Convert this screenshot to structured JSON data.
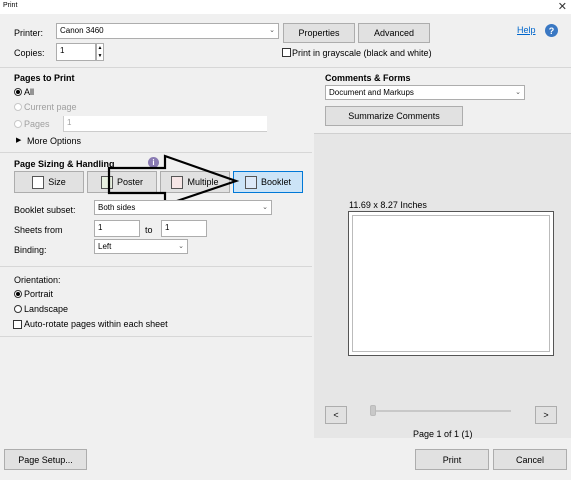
{
  "window": {
    "title": "Print"
  },
  "printer": {
    "label": "Printer:",
    "value": "Canon 3460",
    "properties_label": "Properties",
    "advanced_label": "Advanced"
  },
  "copies": {
    "label": "Copies:",
    "value": "1"
  },
  "grayscale": {
    "label": "Print in grayscale (black and white)"
  },
  "help": {
    "label": "Help"
  },
  "pages_to_print": {
    "title": "Pages to Print",
    "all_label": "All",
    "current_label": "Current page",
    "pages_label": "Pages",
    "pages_value": "1",
    "more_options_label": "More Options"
  },
  "sizing": {
    "title": "Page Sizing & Handling",
    "buttons": {
      "size": "Size",
      "poster": "Poster",
      "multiple": "Multiple",
      "booklet": "Booklet"
    },
    "subset_label": "Booklet subset:",
    "subset_value": "Both sides",
    "sheets_label": "Sheets from",
    "sheets_from": "1",
    "to_label": "to",
    "sheets_to": "1",
    "binding_label": "Binding:",
    "binding_value": "Left"
  },
  "orientation": {
    "title": "Orientation:",
    "portrait_label": "Portrait",
    "landscape_label": "Landscape",
    "autorotate_label": "Auto-rotate pages within each sheet"
  },
  "comments": {
    "title": "Comments & Forms",
    "value": "Document and Markups",
    "summarize_label": "Summarize Comments"
  },
  "preview": {
    "size_text": "11.69 x 8.27 Inches",
    "prev_label": "<",
    "next_label": ">",
    "page_text": "Page 1 of 1 (1)"
  },
  "footer": {
    "page_setup_label": "Page Setup...",
    "print_label": "Print",
    "cancel_label": "Cancel"
  },
  "colors": {
    "accent": "#0078d7",
    "active_button": "#cce4f7",
    "link": "#0066cc",
    "background": "#f0f0f0"
  }
}
